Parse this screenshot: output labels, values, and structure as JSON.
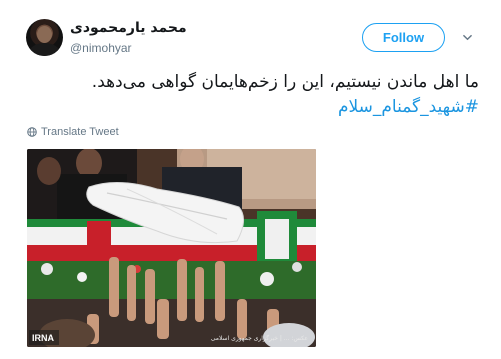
{
  "author": {
    "display_name": "محمد یارمحمودی",
    "handle": "@nimohyar",
    "avatar_icon": "user-avatar"
  },
  "follow_button": {
    "label": "Follow",
    "color": "#1da1f2"
  },
  "menu_icon": "chevron-down-icon",
  "tweet": {
    "text": "ما اهل ماندن نیستیم، این را زخم‌هایمان گواهی می‌دهد.",
    "hashtag": "#شهید_گمنام_سلام",
    "hashtag_color": "#1b95e0"
  },
  "translate": {
    "label": "Translate Tweet",
    "icon": "globe-icon"
  },
  "media": {
    "description_icon": "funeral-photo",
    "watermark_logo": "IRNA",
    "watermark_caption": "عکس: ... | خبرگزاری جمهوری اسلامی"
  }
}
